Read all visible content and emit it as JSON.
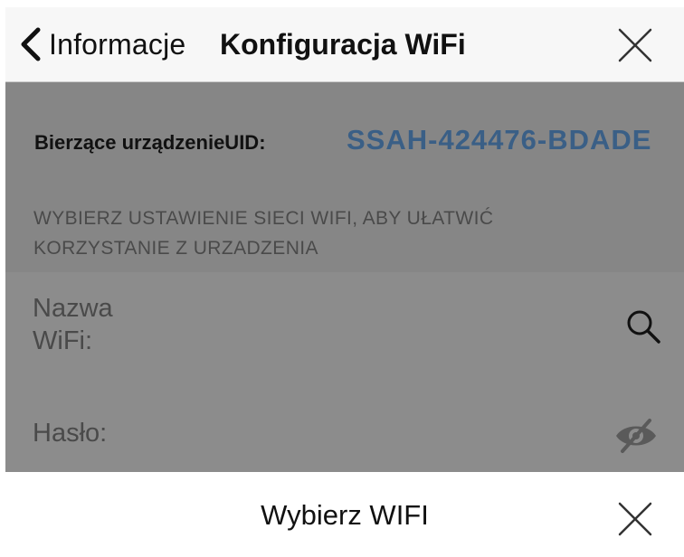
{
  "header": {
    "back_label": "Informacje",
    "title": "Konfiguracja WiFi",
    "back_icon": "chevron-left-icon",
    "close_icon": "close-icon"
  },
  "device": {
    "uid_label": "Bierzące urządzenieUID:",
    "uid_value": "SSAH-424476-BDADE",
    "uid_color": "#3a5f86"
  },
  "hint": {
    "text": "WYBIERZ USTAWIENIE SIECI WIFI, ABY UŁATWIĆ KORZYSTANIE Z URZADZENIA"
  },
  "form": {
    "wifi_label": "Nazwa WiFi:",
    "wifi_value": "",
    "search_icon": "search-icon",
    "password_label": "Hasło:",
    "password_value": "",
    "visibility_icon": "eye-slash-icon"
  },
  "sheet": {
    "title": "Wybierz WIFI",
    "close_icon": "close-icon"
  },
  "colors": {
    "overlay": "#8a8a8a",
    "header_bg": "#f7f7f7",
    "accent": "#3a5f86"
  }
}
